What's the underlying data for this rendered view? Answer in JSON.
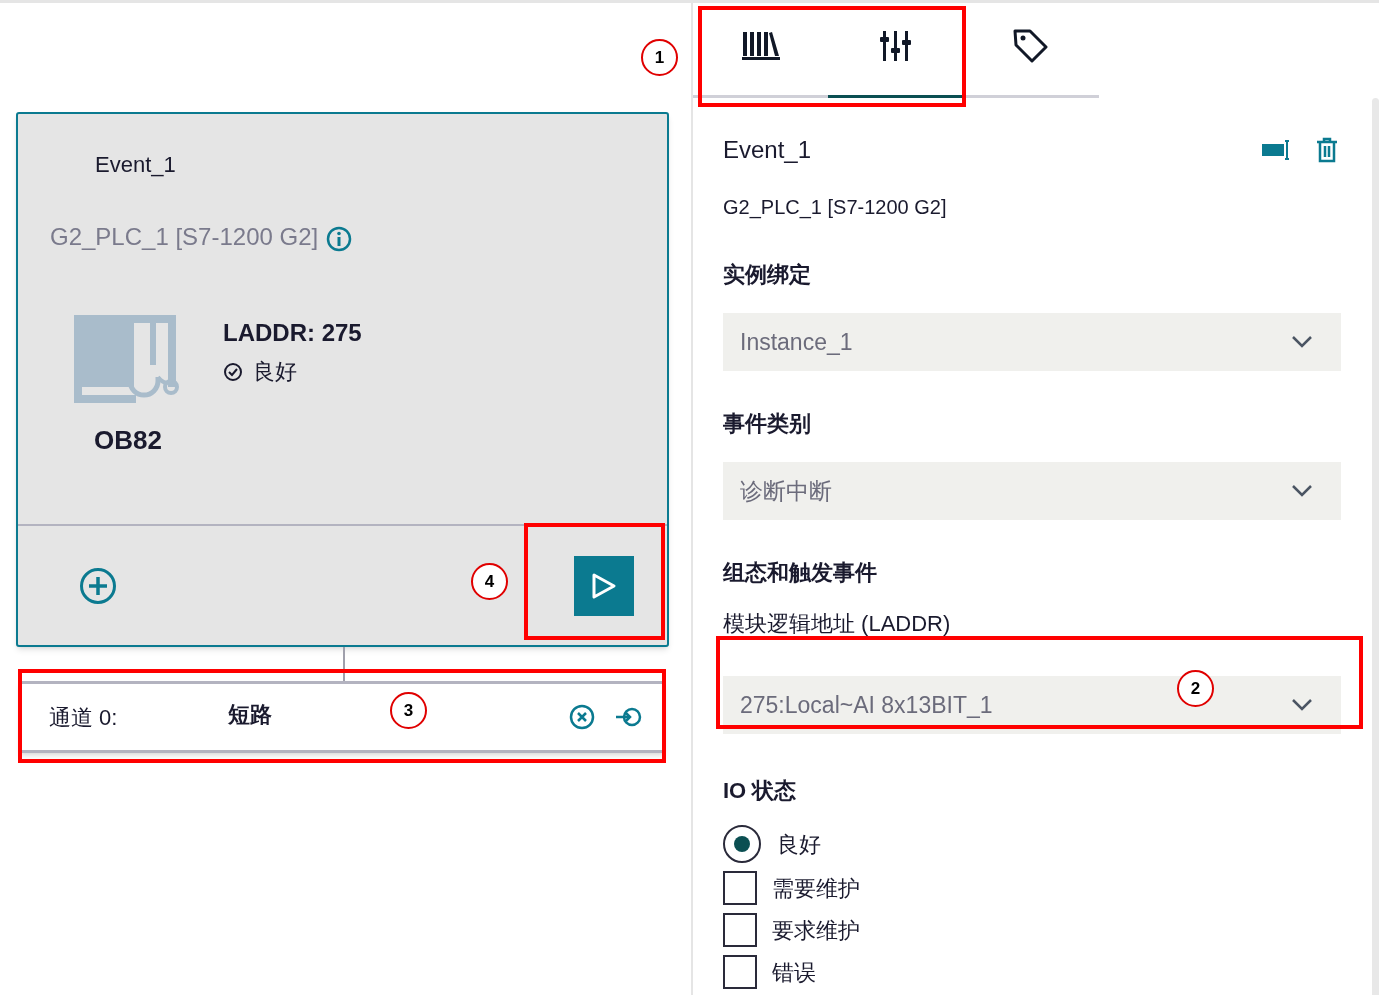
{
  "event_card": {
    "title": "Event_1",
    "device": "G2_PLC_1 [S7-1200 G2]",
    "laddr": "LADDR: 275",
    "status": "良好",
    "block": "OB82"
  },
  "channel_row": {
    "label": "通道 0:",
    "value": "短路"
  },
  "tabs": [
    {
      "kind": "library",
      "selected": false
    },
    {
      "kind": "sliders",
      "selected": true
    },
    {
      "kind": "tag",
      "selected": false
    }
  ],
  "properties": {
    "title": "Event_1",
    "device": "G2_PLC_1 [S7-1200 G2]",
    "sections": [
      {
        "heading": "实例绑定",
        "value": "Instance_1"
      },
      {
        "heading": "事件类别",
        "value": "诊断中断"
      },
      {
        "heading": "组态和触发事件",
        "label": "模块逻辑地址 (LADDR)",
        "value": "275:Local~AI 8x13BIT_1"
      }
    ],
    "io_heading": "IO 状态",
    "io_options": [
      {
        "kind": "radio",
        "label": "良好",
        "selected": true
      },
      {
        "kind": "checkbox",
        "label": "需要维护",
        "checked": false
      },
      {
        "kind": "checkbox",
        "label": "要求维护",
        "checked": false
      },
      {
        "kind": "checkbox",
        "label": "错误",
        "checked": false
      }
    ]
  },
  "callouts": [
    {
      "number": "1"
    },
    {
      "number": "2"
    },
    {
      "number": "3"
    },
    {
      "number": "4"
    }
  ]
}
